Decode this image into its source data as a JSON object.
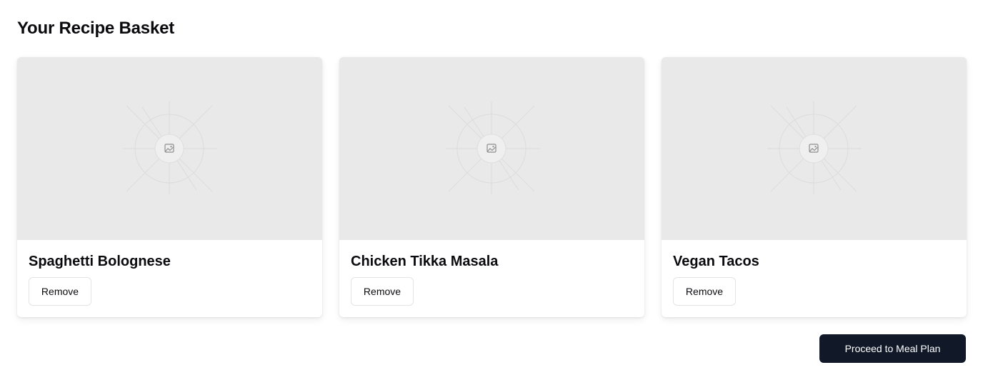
{
  "header": {
    "title": "Your Recipe Basket"
  },
  "recipes": [
    {
      "title": "Spaghetti Bolognese",
      "remove_label": "Remove",
      "image_icon": "image-placeholder-icon"
    },
    {
      "title": "Chicken Tikka Masala",
      "remove_label": "Remove",
      "image_icon": "image-placeholder-icon"
    },
    {
      "title": "Vegan Tacos",
      "remove_label": "Remove",
      "image_icon": "image-placeholder-icon"
    }
  ],
  "actions": {
    "proceed_label": "Proceed to Meal Plan"
  },
  "colors": {
    "image_placeholder_bg": "#e9e9e9",
    "primary_button_bg": "#111827",
    "primary_button_text": "#ffffff"
  }
}
